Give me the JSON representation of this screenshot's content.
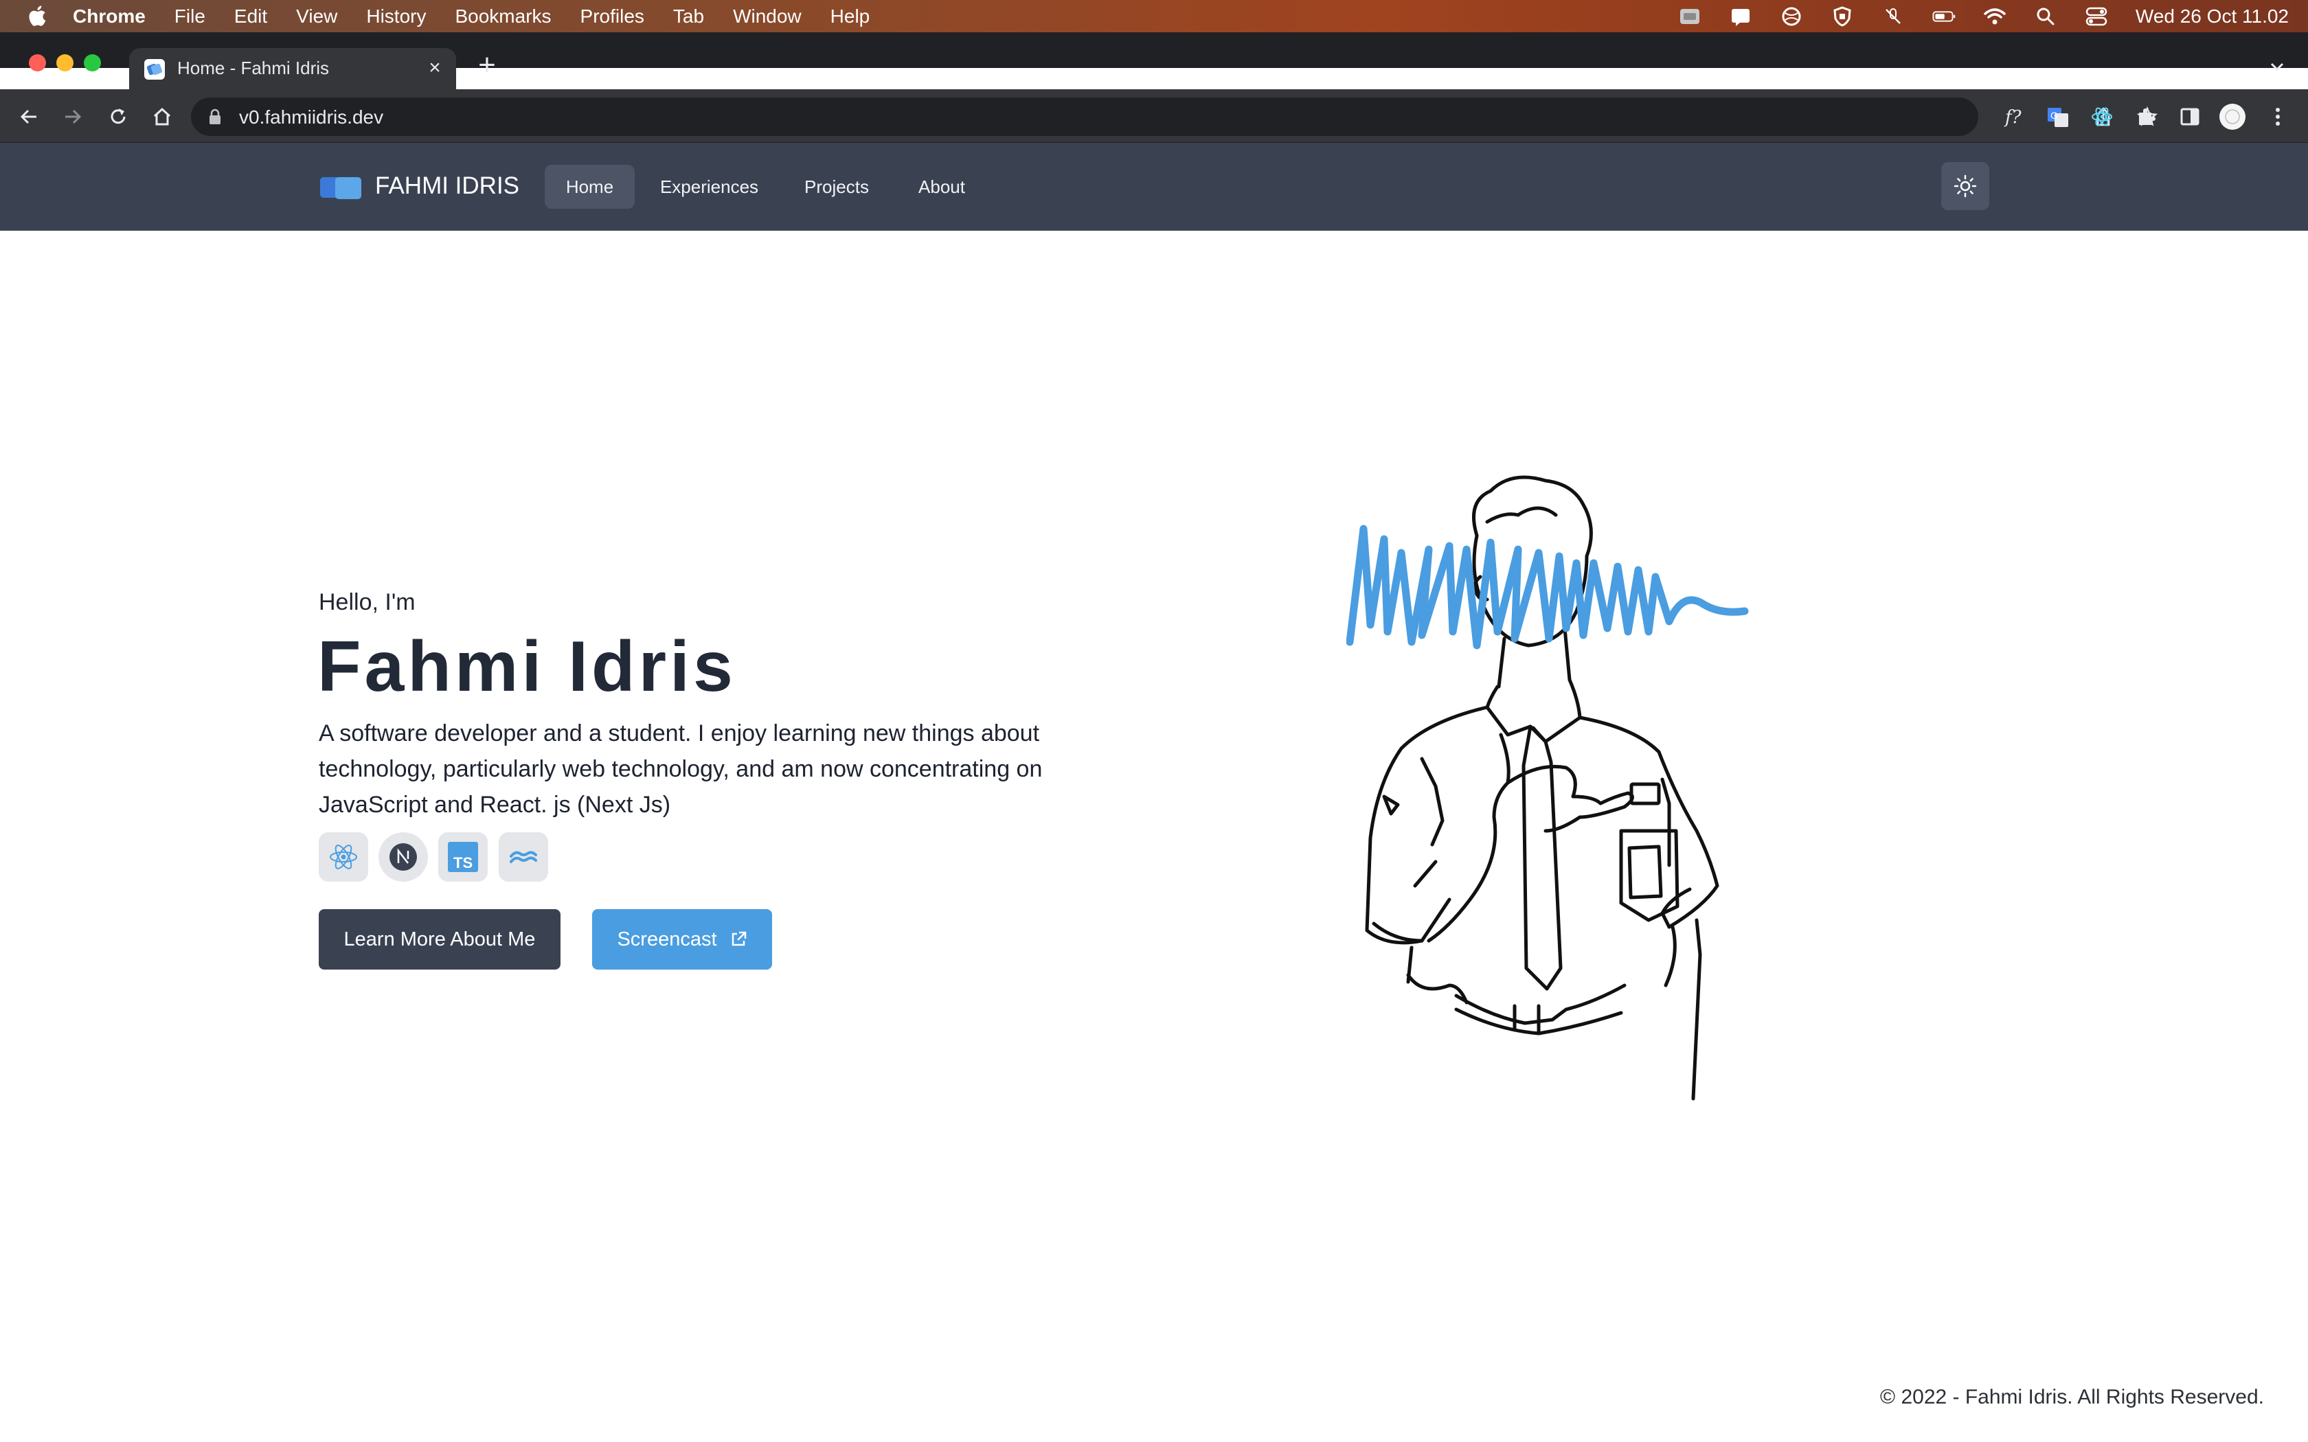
{
  "menubar": {
    "app_name": "Chrome",
    "menus": [
      "File",
      "Edit",
      "View",
      "History",
      "Bookmarks",
      "Profiles",
      "Tab",
      "Window",
      "Help"
    ],
    "clock": "Wed 26 Oct  11.02"
  },
  "browser": {
    "tab_title": "Home - Fahmi Idris",
    "url": "v0.fahmiidris.dev"
  },
  "site": {
    "brand": "FAHMI IDRIS",
    "nav": {
      "home": "Home",
      "experiences": "Experiences",
      "projects": "Projects",
      "about": "About"
    },
    "active_nav": "Home"
  },
  "hero": {
    "greeting": "Hello, I'm",
    "name": "Fahmi Idris",
    "bio": "A software developer and a student. I enjoy learning new things about technology, particularly web technology, and am now concentrating on JavaScript and React. js (Next Js)",
    "tech_icons": [
      "react-icon",
      "nextjs-icon",
      "typescript-icon",
      "tailwind-icon"
    ],
    "primary_button": "Learn More About Me",
    "secondary_button": "Screencast"
  },
  "footer": {
    "copyright": "© 2022 - Fahmi Idris. All Rights Reserved."
  },
  "colors": {
    "header_bg": "#3a4252",
    "accent_blue": "#4a9de0",
    "dark_text": "#222a38"
  }
}
